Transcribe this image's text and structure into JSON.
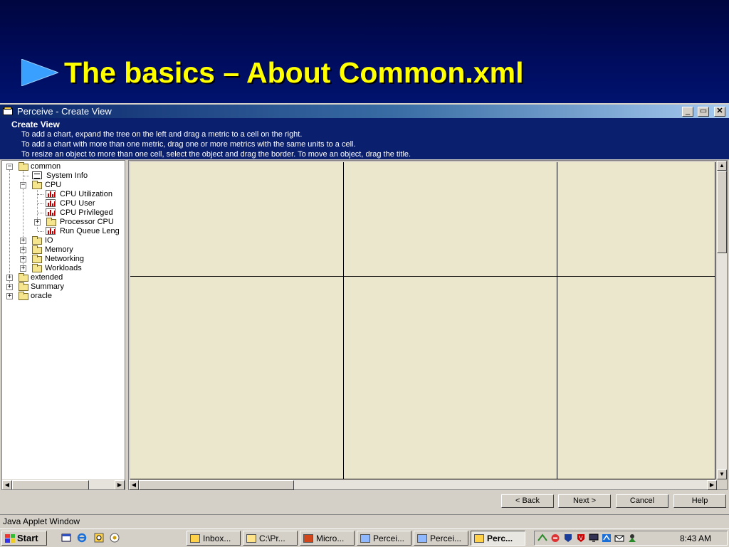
{
  "slide": {
    "title": "The basics – About Common.xml"
  },
  "window": {
    "title": "Perceive - Create View",
    "controls": {
      "minimize": "_",
      "maximize": "▭",
      "close": "✕"
    }
  },
  "header": {
    "heading": "Create View",
    "instructions": [
      "To add a chart, expand the tree on the left and drag a metric to a cell on the right.",
      "To add a chart with more than one metric, drag one or more metrics with the same units to a cell.",
      "To resize an object to more than one cell, select the object and drag the border.  To move an object, drag the title."
    ]
  },
  "tree": {
    "common": "common",
    "system_info": "System Info",
    "cpu": "CPU",
    "cpu_utilization": "CPU Utilization",
    "cpu_user": "CPU User",
    "cpu_privileged": "CPU Privileged",
    "processor_cpu": "Processor CPU",
    "run_queue": "Run Queue Leng",
    "io": "IO",
    "memory": "Memory",
    "networking": "Networking",
    "workloads": "Workloads",
    "extended": "extended",
    "summary": "Summary",
    "oracle": "oracle"
  },
  "buttons": {
    "back": "< Back",
    "next": "Next >",
    "cancel": "Cancel",
    "help": "Help"
  },
  "applet_status": "Java Applet Window",
  "taskbar": {
    "start": "Start",
    "tasks": [
      "Inbox...",
      "C:\\Pr...",
      "Micro...",
      "Percei...",
      "Percei...",
      "Perc..."
    ],
    "clock": "8:43 AM"
  },
  "colors": {
    "slide_bg": "#000a5c",
    "title_text": "#ffff00",
    "header_bg": "#0a1f6e",
    "grid_cell_bg": "#ebe7cc"
  }
}
